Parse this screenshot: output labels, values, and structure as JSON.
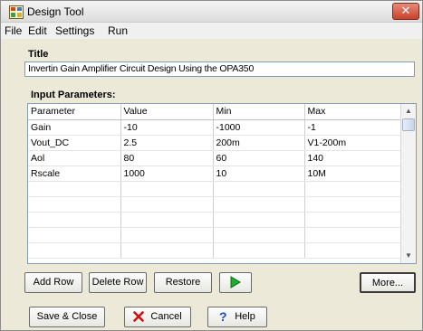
{
  "window": {
    "title": "Design Tool",
    "close_glyph": "✕"
  },
  "menu": {
    "items": [
      {
        "label": "File"
      },
      {
        "label": "Edit"
      },
      {
        "label": "Settings"
      },
      {
        "label": "Run"
      }
    ]
  },
  "title_section": {
    "label": "Title",
    "value": "Invertin Gain Amplifier Circuit Design Using the OPA350"
  },
  "parameters": {
    "label": "Input Parameters:",
    "columns": [
      "Parameter",
      "Value",
      "Min",
      "Max"
    ],
    "rows": [
      [
        "Gain",
        "-10",
        "-1000",
        "-1"
      ],
      [
        "Vout_DC",
        "2.5",
        "200m",
        "V1-200m"
      ],
      [
        "Aol",
        "80",
        "60",
        "140"
      ],
      [
        "Rscale",
        "1000",
        "10",
        "10M"
      ]
    ],
    "empty_rows": 5
  },
  "buttons": {
    "add_row": "Add Row",
    "delete_row": "Delete Row",
    "restore": "Restore",
    "more": "More...",
    "save_close": "Save & Close",
    "cancel": "Cancel",
    "help": "Help"
  },
  "colors": {
    "run_arrow": "#1fae2b",
    "cancel_x": "#d01010",
    "help_q": "#1a4bc4"
  },
  "icons": {
    "app": "design-tool-icon",
    "run": "play-arrow-icon",
    "cancel": "red-x-icon",
    "help": "question-mark-icon"
  }
}
